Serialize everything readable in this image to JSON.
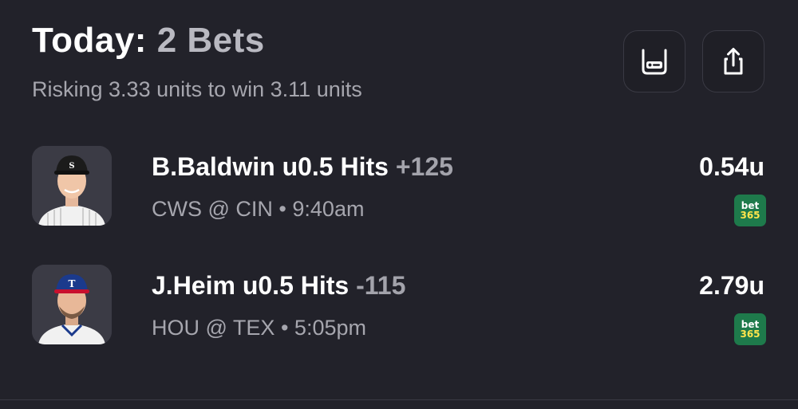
{
  "header": {
    "title_prefix": "Today:",
    "title_count": "2 Bets",
    "subtitle": "Risking 3.33 units to win 3.11 units"
  },
  "actions": {
    "bet_slip_icon": "bet-slip-icon",
    "share_icon": "share-icon"
  },
  "bets": [
    {
      "player": "B.Baldwin u0.5 Hits",
      "odds": "+125",
      "matchup": "CWS @ CIN",
      "separator": "•",
      "time": "9:40am",
      "units": "0.54u",
      "book": {
        "line1": "bet",
        "line2": "365"
      },
      "avatar_colors": {
        "cap": "#1b1b1b",
        "jersey": "#f1f1f1"
      }
    },
    {
      "player": "J.Heim u0.5 Hits",
      "odds": "-115",
      "matchup": "HOU @ TEX",
      "separator": "•",
      "time": "5:05pm",
      "units": "2.79u",
      "book": {
        "line1": "bet",
        "line2": "365"
      },
      "avatar_colors": {
        "cap": "#1b3a8c",
        "jersey": "#f1f1f1"
      }
    }
  ],
  "colors": {
    "background": "#22222a",
    "muted_text": "#a6a6ae",
    "book_badge": "#1e7a4b",
    "book_accent": "#ffe54c"
  }
}
